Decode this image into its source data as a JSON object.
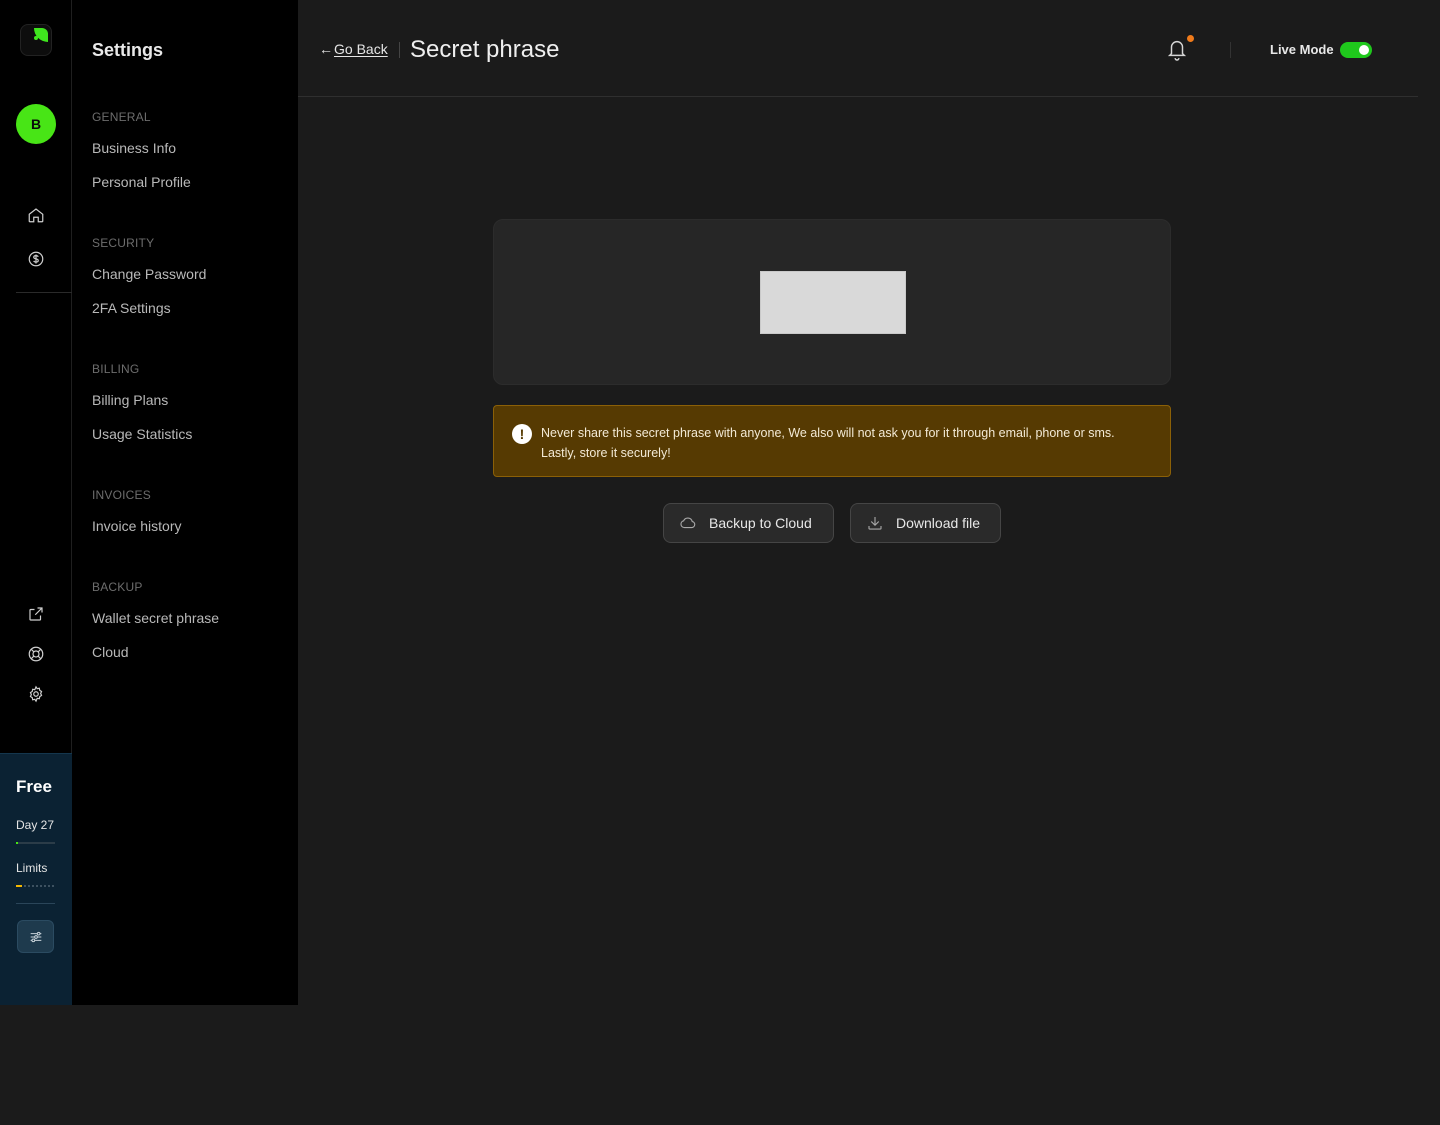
{
  "rail": {
    "avatar_initial": "B",
    "icons": [
      "home-icon",
      "dollar-circle-icon",
      "external-link-icon",
      "lifebuoy-icon",
      "gear-icon"
    ]
  },
  "plan": {
    "name": "Free",
    "day_label": "Day 27",
    "day_progress": 0.05,
    "limits_label": "Limits",
    "limits_progress": 0.15,
    "colors": {
      "day_fill": "#48e516",
      "limits_fill": "#f5b700"
    }
  },
  "sidebar": {
    "title": "Settings",
    "sections": [
      {
        "label": "GENERAL",
        "items": [
          "Business Info",
          "Personal Profile"
        ]
      },
      {
        "label": "SECURITY",
        "items": [
          "Change Password",
          "2FA Settings"
        ]
      },
      {
        "label": "BILLING",
        "items": [
          "Billing Plans",
          "Usage Statistics"
        ]
      },
      {
        "label": "INVOICES",
        "items": [
          "Invoice history"
        ]
      },
      {
        "label": "BACKUP",
        "items": [
          "Wallet secret phrase",
          "Cloud"
        ]
      }
    ]
  },
  "header": {
    "back_label": "Go Back",
    "title": "Secret phrase",
    "live_mode_label": "Live Mode",
    "live_mode_on": true
  },
  "warning": {
    "text": "Never share this secret phrase with anyone, We also will not ask you for it through email, phone or sms. Lastly, store it securely!"
  },
  "actions": {
    "backup_label": "Backup to Cloud",
    "download_label": "Download file"
  },
  "colors": {
    "accent_green": "#48e516",
    "notification_badge": "#f07b1b",
    "warning_bg": "#563a02"
  }
}
